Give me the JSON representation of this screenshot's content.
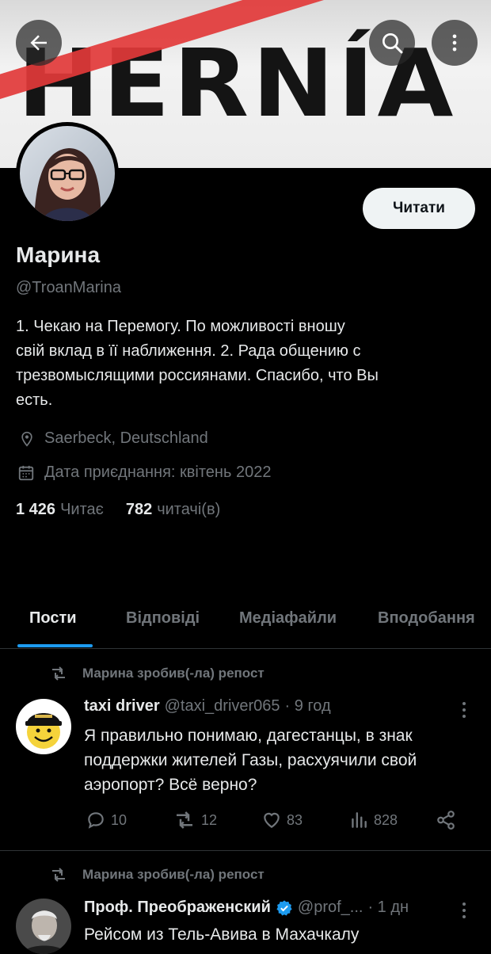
{
  "banner": {
    "text": "HERNÍA"
  },
  "header": {
    "back_icon": "arrow-left-icon",
    "search_icon": "search-icon",
    "more_icon": "more-vertical-icon"
  },
  "profile": {
    "follow_label": "Читати",
    "name": "Марина",
    "handle": "@TroanMarina",
    "bio_lines": [
      "1. Чекаю на Перемогу. По можливості вношу",
      "свій вклад в її наближення.  2. Рада общению с",
      "трезвомыслящими россиянами. Спасибо, что Вы",
      "есть."
    ],
    "location": "Saerbeck, Deutschland",
    "joined": "Дата приєднання: квітень 2022",
    "following_count": "1 426",
    "following_label": "Читає",
    "followers_count": "782",
    "followers_label": "читачі(в)"
  },
  "tabs": [
    {
      "label": "Пости",
      "active": true
    },
    {
      "label": "Відповіді",
      "active": false
    },
    {
      "label": "Медіафайли",
      "active": false
    },
    {
      "label": "Вподобання",
      "active": false
    }
  ],
  "tweets": [
    {
      "repost_label": "Марина зробив(-ла) репост",
      "name": "taxi driver",
      "handle": "@taxi_driver065",
      "time": "· 9 год",
      "text_lines": [
        "Я правильно понимаю, дагестанцы, в знак",
        "поддержки жителей Газы, расхуячили свой",
        "аэропорт? Всё верно?"
      ],
      "replies": "10",
      "reposts": "12",
      "likes": "83",
      "views": "828"
    },
    {
      "repost_label": "Марина зробив(-ла) репост",
      "name": "Проф. Преображенский",
      "handle": "@prof_...",
      "time": "· 1 дн",
      "verified": true,
      "text_lines": [
        "Рейсом из Тель-Авива в Махачкалу"
      ]
    }
  ],
  "colors": {
    "accent": "#1d9bf0",
    "muted": "#71767b",
    "background": "#000000",
    "banner_stripe": "#e23a3a"
  }
}
